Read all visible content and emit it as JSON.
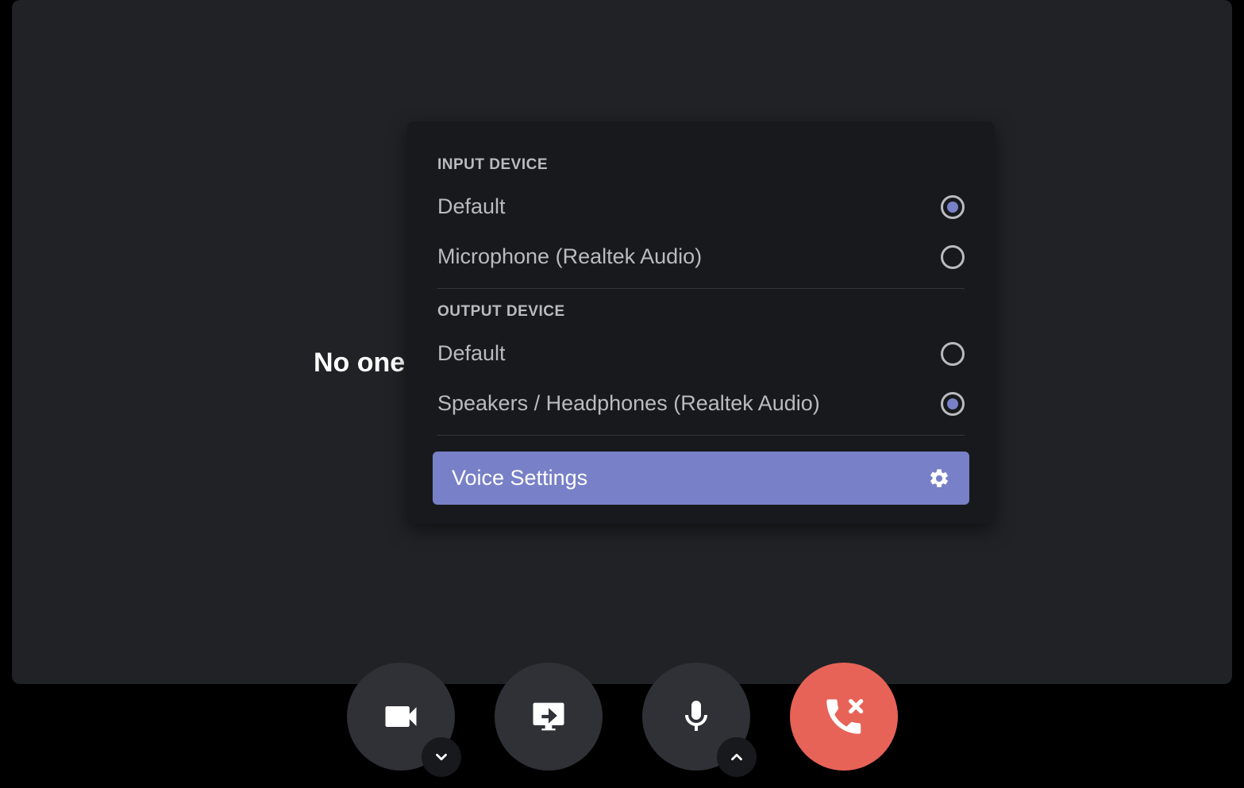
{
  "background_text": "No one",
  "popup": {
    "input_header": "Input Device",
    "output_header": "Output Device",
    "input_options": [
      {
        "label": "Default",
        "selected": true
      },
      {
        "label": "Microphone (Realtek Audio)",
        "selected": false
      }
    ],
    "output_options": [
      {
        "label": "Default",
        "selected": false
      },
      {
        "label": "Speakers / Headphones (Realtek Audio)",
        "selected": true
      }
    ],
    "voice_settings_label": "Voice Settings"
  },
  "controls": {
    "video": "video-icon",
    "screenshare": "screenshare-icon",
    "mic": "microphone-icon",
    "disconnect": "disconnect-icon"
  }
}
